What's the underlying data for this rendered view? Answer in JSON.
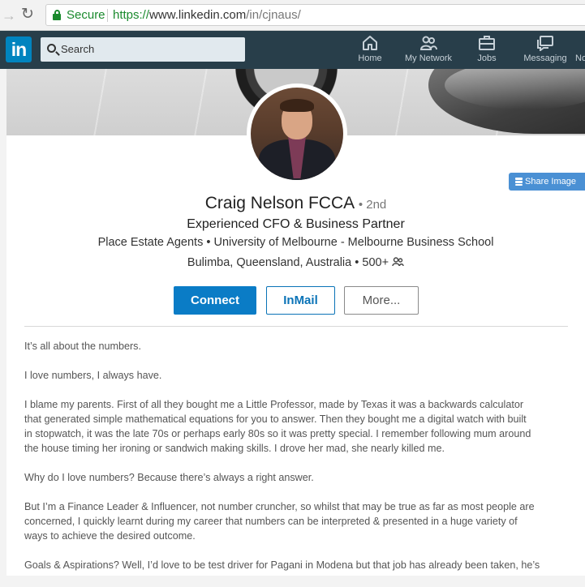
{
  "browser": {
    "secure_label": "Secure",
    "url_scheme": "https://",
    "url_host": "www.linkedin.com",
    "url_path": "/in/cjnaus/"
  },
  "header": {
    "logo_text": "in",
    "search_placeholder": "Search",
    "nav": [
      {
        "label": "Home",
        "icon": "home-icon"
      },
      {
        "label": "My Network",
        "icon": "network-icon"
      },
      {
        "label": "Jobs",
        "icon": "briefcase-icon"
      },
      {
        "label": "Messaging",
        "icon": "messaging-icon"
      },
      {
        "label": "No",
        "icon": "notifications-icon"
      }
    ]
  },
  "profile": {
    "share_image_label": "Share Image",
    "name": "Craig Nelson FCCA",
    "degree": "• 2nd",
    "headline": "Experienced CFO & Business Partner",
    "company": "Place Estate Agents",
    "school": "University of Melbourne - Melbourne Business School",
    "location": "Bulimba, Queensland, Australia",
    "connections": "500+",
    "buttons": {
      "connect": "Connect",
      "inmail": "InMail",
      "more": "More..."
    }
  },
  "summary": {
    "lines": [
      [
        "It’s all about the numbers."
      ],
      [
        "I love numbers, I always have."
      ],
      [
        "I blame my parents. First of all they bought me a Little Professor, made by Texas it was a backwards calculator",
        "that generated simple mathematical equations for you to answer. Then they bought me a digital watch with built",
        "in stopwatch, it was the late 70s or perhaps early 80s so it was pretty special. I remember following mum around",
        "the house timing her ironing or sandwich making skills. I drove her mad, she nearly killed me."
      ],
      [
        "Why do I love numbers? Because there’s always a right answer."
      ],
      [
        "But I’m a Finance Leader & Influencer, not number cruncher, so whilst that may be true as far as most people are",
        "concerned, I quickly learnt during my career that numbers can be interpreted & presented in a huge variety of",
        "ways to achieve the desired outcome."
      ],
      [
        "Goals & Aspirations? Well, I’d love to be test driver for Pagani in Modena but that job has already been taken, he’s"
      ]
    ]
  },
  "colors": {
    "linkedin_header": "#283e4a",
    "linkedin_blue": "#0084bf",
    "connect_button": "#0a7cc6",
    "secure_green": "#1a8a2d"
  }
}
